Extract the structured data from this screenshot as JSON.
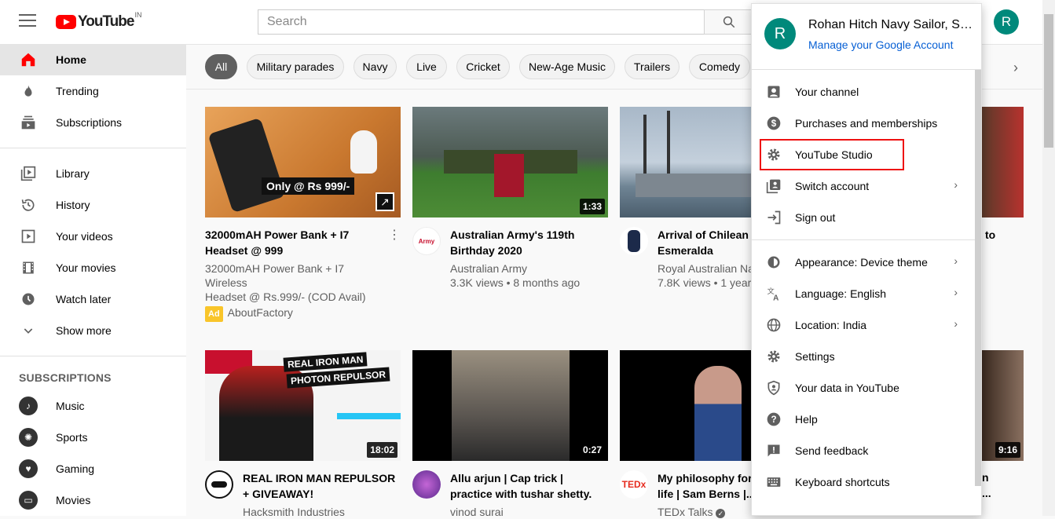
{
  "header": {
    "logo_text": "YouTube",
    "region": "IN",
    "search_placeholder": "Search",
    "avatar_letter": "R"
  },
  "sidebar": {
    "main": [
      {
        "label": "Home",
        "icon": "home-icon",
        "active": true
      },
      {
        "label": "Trending",
        "icon": "flame-icon"
      },
      {
        "label": "Subscriptions",
        "icon": "subscriptions-icon"
      }
    ],
    "library": [
      {
        "label": "Library",
        "icon": "library-icon"
      },
      {
        "label": "History",
        "icon": "history-icon"
      },
      {
        "label": "Your videos",
        "icon": "your-videos-icon"
      },
      {
        "label": "Your movies",
        "icon": "film-icon"
      },
      {
        "label": "Watch later",
        "icon": "clock-icon"
      },
      {
        "label": "Show more",
        "icon": "chevron-down-icon"
      }
    ],
    "subscriptions_heading": "SUBSCRIPTIONS",
    "subscriptions": [
      {
        "label": "Music",
        "icon": "music-icon"
      },
      {
        "label": "Sports",
        "icon": "sports-icon"
      },
      {
        "label": "Gaming",
        "icon": "gaming-icon"
      },
      {
        "label": "Movies",
        "icon": "movies-icon"
      }
    ]
  },
  "chips": [
    "All",
    "Military parades",
    "Navy",
    "Live",
    "Cricket",
    "New-Age Music",
    "Trailers",
    "Comedy"
  ],
  "videos": [
    {
      "title1": "32000mAH Power Bank + I7",
      "title2": "Headset @ 999",
      "meta1": "32000mAH Power Bank + I7 Wireless",
      "meta2": "Headset @ Rs.999/- (COD Avail)",
      "ad_label": "Ad",
      "channel": "AboutFactory",
      "thumb_text": "Only @ Rs 999/-",
      "duration": ""
    },
    {
      "title1": "Australian Army's 119th",
      "title2": "Birthday 2020",
      "meta1": "Australian Army",
      "meta2": "3.3K views • 8 months ago",
      "avatar_text": "Army",
      "duration": "1:33"
    },
    {
      "title1": "Arrival of Chilean ta",
      "title2": "Esmeralda",
      "meta1": "Royal Australian Na",
      "meta2": "7.8K views • 1 year",
      "duration": ""
    },
    {
      "title1": "REAL IRON MAN REPULSOR",
      "title2": "+ GIVEAWAY!",
      "meta1": "Hacksmith Industries",
      "thumb_line1": "REAL IRON MAN",
      "thumb_line2": "PHOTON REPULSOR",
      "duration": "18:02"
    },
    {
      "title1": "Allu arjun | Cap trick |",
      "title2": "practice with tushar shetty.",
      "meta1": "vinod surai",
      "duration": "0:27"
    },
    {
      "title1": "My philosophy for a",
      "title2": "life | Sam Berns |...",
      "meta1": "TEDx Talks",
      "avatar_text": "TEDx",
      "duration": ""
    }
  ],
  "right_col": {
    "duration_bottom": "9:16",
    "partial_title": "to",
    "partial_title2": "n",
    "partial_title3": "..."
  },
  "account_menu": {
    "name": "Rohan Hitch Navy Sailor, Sy...",
    "manage": "Manage your Google Account",
    "avatar_letter": "R",
    "group1": [
      {
        "label": "Your channel",
        "icon": "person-icon"
      },
      {
        "label": "Purchases and memberships",
        "icon": "dollar-icon"
      },
      {
        "label": "YouTube Studio",
        "icon": "gear-icon",
        "highlight": true
      },
      {
        "label": "Switch account",
        "icon": "switch-account-icon",
        "chevron": true
      },
      {
        "label": "Sign out",
        "icon": "sign-out-icon"
      }
    ],
    "group2": [
      {
        "label": "Appearance: Device theme",
        "icon": "appearance-icon",
        "chevron": true
      },
      {
        "label": "Language: English",
        "icon": "translate-icon",
        "chevron": true
      },
      {
        "label": "Location: India",
        "icon": "globe-icon",
        "chevron": true
      },
      {
        "label": "Settings",
        "icon": "gear-icon"
      },
      {
        "label": "Your data in YouTube",
        "icon": "shield-person-icon"
      },
      {
        "label": "Help",
        "icon": "help-icon"
      },
      {
        "label": "Send feedback",
        "icon": "feedback-icon"
      },
      {
        "label": "Keyboard shortcuts",
        "icon": "keyboard-icon"
      }
    ]
  }
}
